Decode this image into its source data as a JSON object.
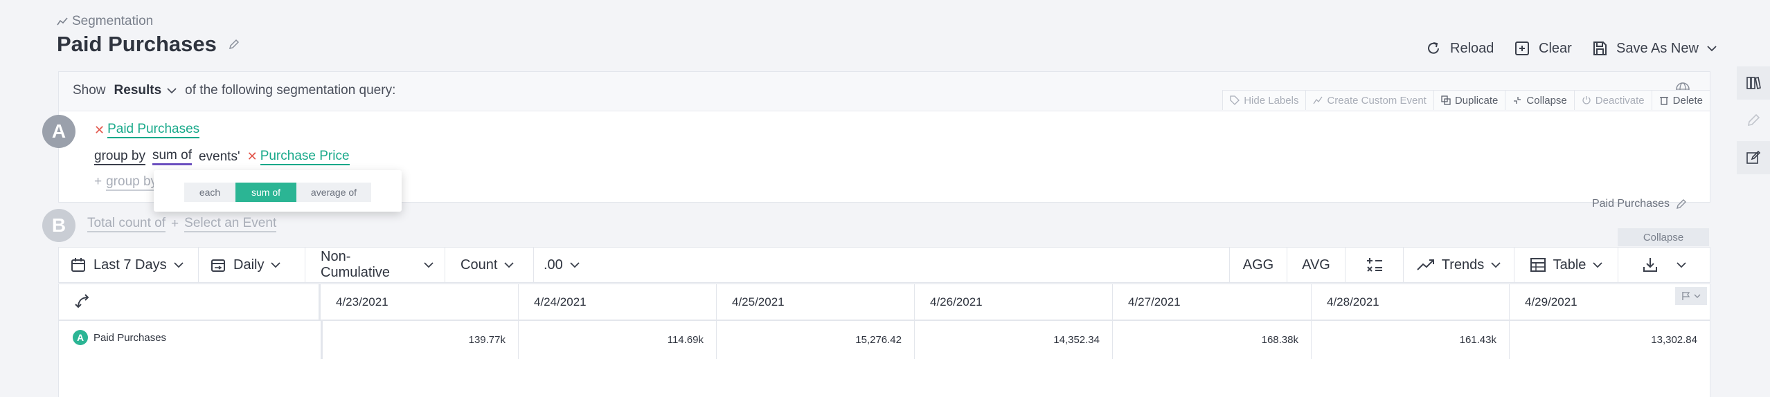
{
  "breadcrumb": "Segmentation",
  "title": "Paid Purchases",
  "actions": {
    "reload": "Reload",
    "clear": "Clear",
    "save_as_new": "Save As New"
  },
  "query": {
    "show_label": "Show",
    "show_value": "Results",
    "show_suffix": "of the following segmentation query:",
    "event_toolbar": [
      "Hide Labels",
      "Create Custom Event",
      "Duplicate",
      "Collapse",
      "Deactivate",
      "Delete"
    ],
    "event_a": {
      "letter": "A",
      "name": "Paid Purchases",
      "group_by": "group by",
      "agg": "sum of",
      "events_word": "events'",
      "property": "Purchase Price",
      "add_group_by": "group by",
      "right_label": "Paid Purchases"
    },
    "agg_options": [
      "each",
      "sum of",
      "average of"
    ],
    "agg_selected": "sum of",
    "event_b": {
      "letter": "B",
      "measure": "Total count of",
      "placeholder": "Select an Event"
    },
    "collapse": "Collapse"
  },
  "controls": {
    "date_range": "Last 7 Days",
    "interval": "Daily",
    "cumulative": "Non-Cumulative",
    "metric": "Count",
    "decimals": ".00",
    "agg": "AGG",
    "avg": "AVG",
    "chart_type": "Trends",
    "view": "Table"
  },
  "table": {
    "columns": [
      "4/23/2021",
      "4/24/2021",
      "4/25/2021",
      "4/26/2021",
      "4/27/2021",
      "4/28/2021",
      "4/29/2021"
    ],
    "row_letter": "A",
    "row_label": "Paid Purchases",
    "values": [
      "139.77k",
      "114.69k",
      "15,276.42",
      "14,352.34",
      "168.38k",
      "161.43k",
      "13,302.84"
    ]
  },
  "colors": {
    "accent": "#2bb594",
    "link": "#18a98a",
    "danger": "#e35a4f",
    "purple": "#6b4fbf"
  }
}
